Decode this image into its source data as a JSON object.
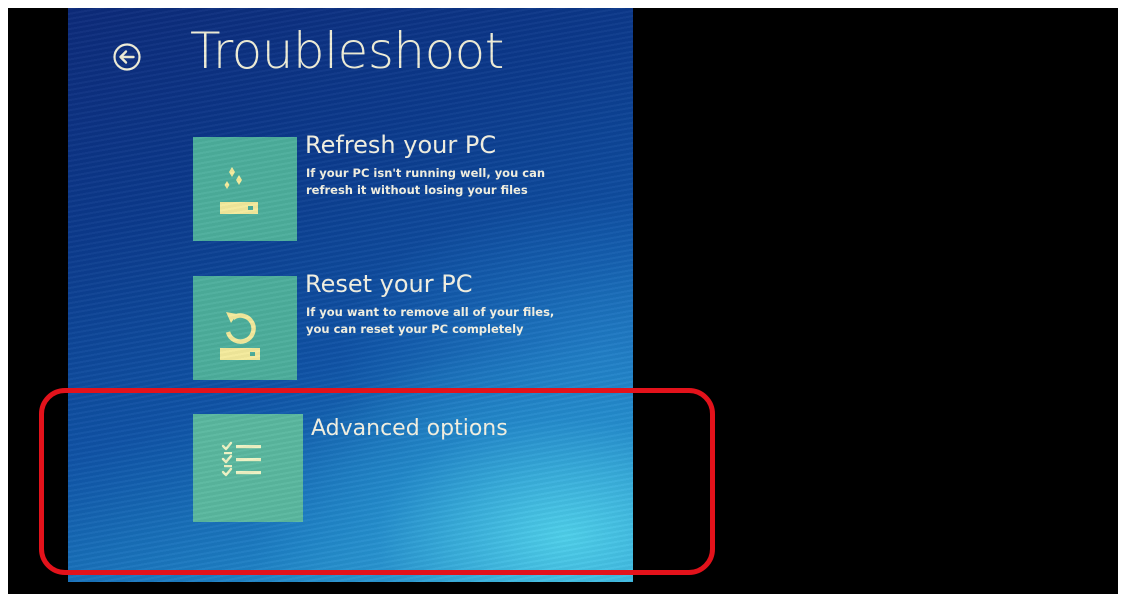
{
  "header": {
    "title": "Troubleshoot",
    "back_icon": "back-arrow-circle-icon"
  },
  "options": [
    {
      "title": "Refresh your PC",
      "description_lines": [
        "If your PC isn't running well, you can",
        "refresh it without losing your files"
      ],
      "icon": "refresh-pc-icon"
    },
    {
      "title": "Reset your PC",
      "description_lines": [
        "If you want to remove all of your files,",
        "you can reset your PC completely"
      ],
      "icon": "reset-pc-icon"
    },
    {
      "title": "Advanced options",
      "icon": "checklist-icon"
    }
  ],
  "colors": {
    "tile": "#4cae9c",
    "text": "#f3f1e2",
    "highlight": "#e3121b",
    "background_top": "#0c2a7a",
    "background_glow": "#3db5de"
  },
  "annotation": {
    "highlighted_option": "Advanced options"
  }
}
